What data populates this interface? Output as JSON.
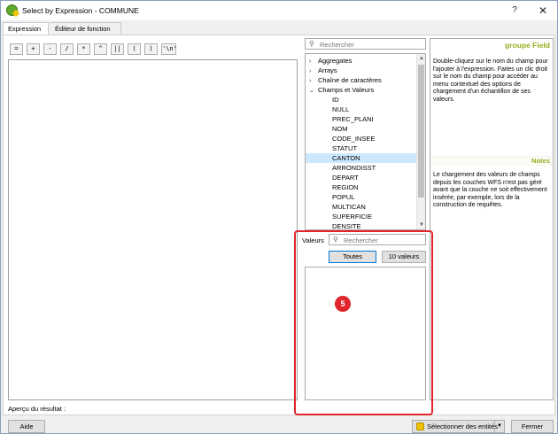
{
  "window": {
    "title": "Select by Expression - COMMUNE",
    "help_symbol": "?",
    "close_symbol": "✕"
  },
  "tabs": [
    {
      "label": "Expression",
      "active": true
    },
    {
      "label": "Éditeur de fonction",
      "active": false
    }
  ],
  "operators": [
    "=",
    "+",
    "-",
    "/",
    "*",
    "^",
    "||",
    "(",
    ")",
    "'\\n'"
  ],
  "preview": {
    "label": "Aperçu du résultat :"
  },
  "functions_search": {
    "placeholder": "Rechercher"
  },
  "tree": {
    "groups": [
      {
        "label": "Aggregates",
        "expanded": false
      },
      {
        "label": "Arrays",
        "expanded": false
      },
      {
        "label": "Chaîne de caractères",
        "expanded": false
      },
      {
        "label": "Champs et Valeurs",
        "expanded": true
      }
    ],
    "fields": [
      "ID",
      "NULL",
      "PREC_PLANI",
      "NOM",
      "CODE_INSEE",
      "STATUT",
      "CANTON",
      "ARRONDISST",
      "DEPART",
      "REGION",
      "POPUL",
      "MULTICAN",
      "SUPERFICIE",
      "DENSITE"
    ],
    "selected_field": "CANTON"
  },
  "help": {
    "title": "groupe Field",
    "body": "Double-cliquez sur le nom du champ pour l'ajouter à l'expression. Faites un clic droit sur le nom du champ pour accéder au menu contextuel des options de chargement d'un échantillon de ses valeurs.",
    "notes_title": "Notes",
    "notes_body": "Le chargement des valeurs de champs depuis les couches WFS n'est pas géré avant que la couche ne soit effectivement insérée, par exemple, lors de la construction de requêtes."
  },
  "values": {
    "label": "Valeurs",
    "search_placeholder": "Rechercher",
    "all_button": "Toutes",
    "ten_button": "10 valeurs"
  },
  "annotation": {
    "number": "5",
    "color": "#e0252c"
  },
  "footer": {
    "help_button": "Aide",
    "select_button": "Sélectionner des entités",
    "close_button": "Fermer"
  },
  "icons": {
    "app": "qgis-icon",
    "search": "search-icon",
    "select": "select-features-icon"
  },
  "colors": {
    "accent": "#0078d7",
    "help_heading": "#93b023",
    "selection": "#cce8ff"
  }
}
